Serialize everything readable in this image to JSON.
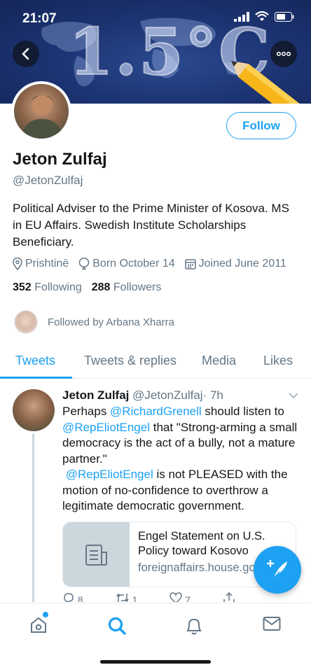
{
  "status_bar": {
    "time": "21:07"
  },
  "banner": {
    "text": "1.5°C"
  },
  "profile": {
    "follow_label": "Follow",
    "name": "Jeton Zulfaj",
    "handle": "@JetonZulfaj",
    "bio": "Political Adviser to the Prime Minister of Kosova. MS in EU Affairs. Swedish Institute Scholarships Beneficiary.",
    "location": "Prishtinë",
    "born": "Born October 14",
    "joined": "Joined June 2011",
    "following_count": "352",
    "following_label": "Following",
    "followers_count": "288",
    "followers_label": "Followers",
    "followed_by": "Followed by Arbana Xharra"
  },
  "tabs": [
    {
      "label": "Tweets"
    },
    {
      "label": "Tweets & replies"
    },
    {
      "label": "Media"
    },
    {
      "label": "Likes"
    }
  ],
  "tweet": {
    "name": "Jeton Zulfaj",
    "handle": "@JetonZulfaj",
    "time": "· 7h",
    "text_1": "Perhaps ",
    "mention_1": "@RichardGrenell",
    "text_2": " should listen to ",
    "mention_2": "@RepEliotEngel",
    "text_3": " that \"Strong-arming a small democracy is the act of a bully, not a mature partner.\"",
    "mention_3": "@RepEliotEngel",
    "text_4": " is not PLEASED with the motion of no-confidence to overthrow a legitimate democratic government.",
    "card_title": "Engel Statement on U.S. Policy toward Kosovo",
    "card_domain": "foreignaffairs.house.gov",
    "reply_count": "8",
    "retweet_count": "1",
    "like_count": "7"
  },
  "colors": {
    "accent": "#1da1f2",
    "text": "#14171a",
    "muted": "#657786",
    "banner": "#1d3575"
  }
}
